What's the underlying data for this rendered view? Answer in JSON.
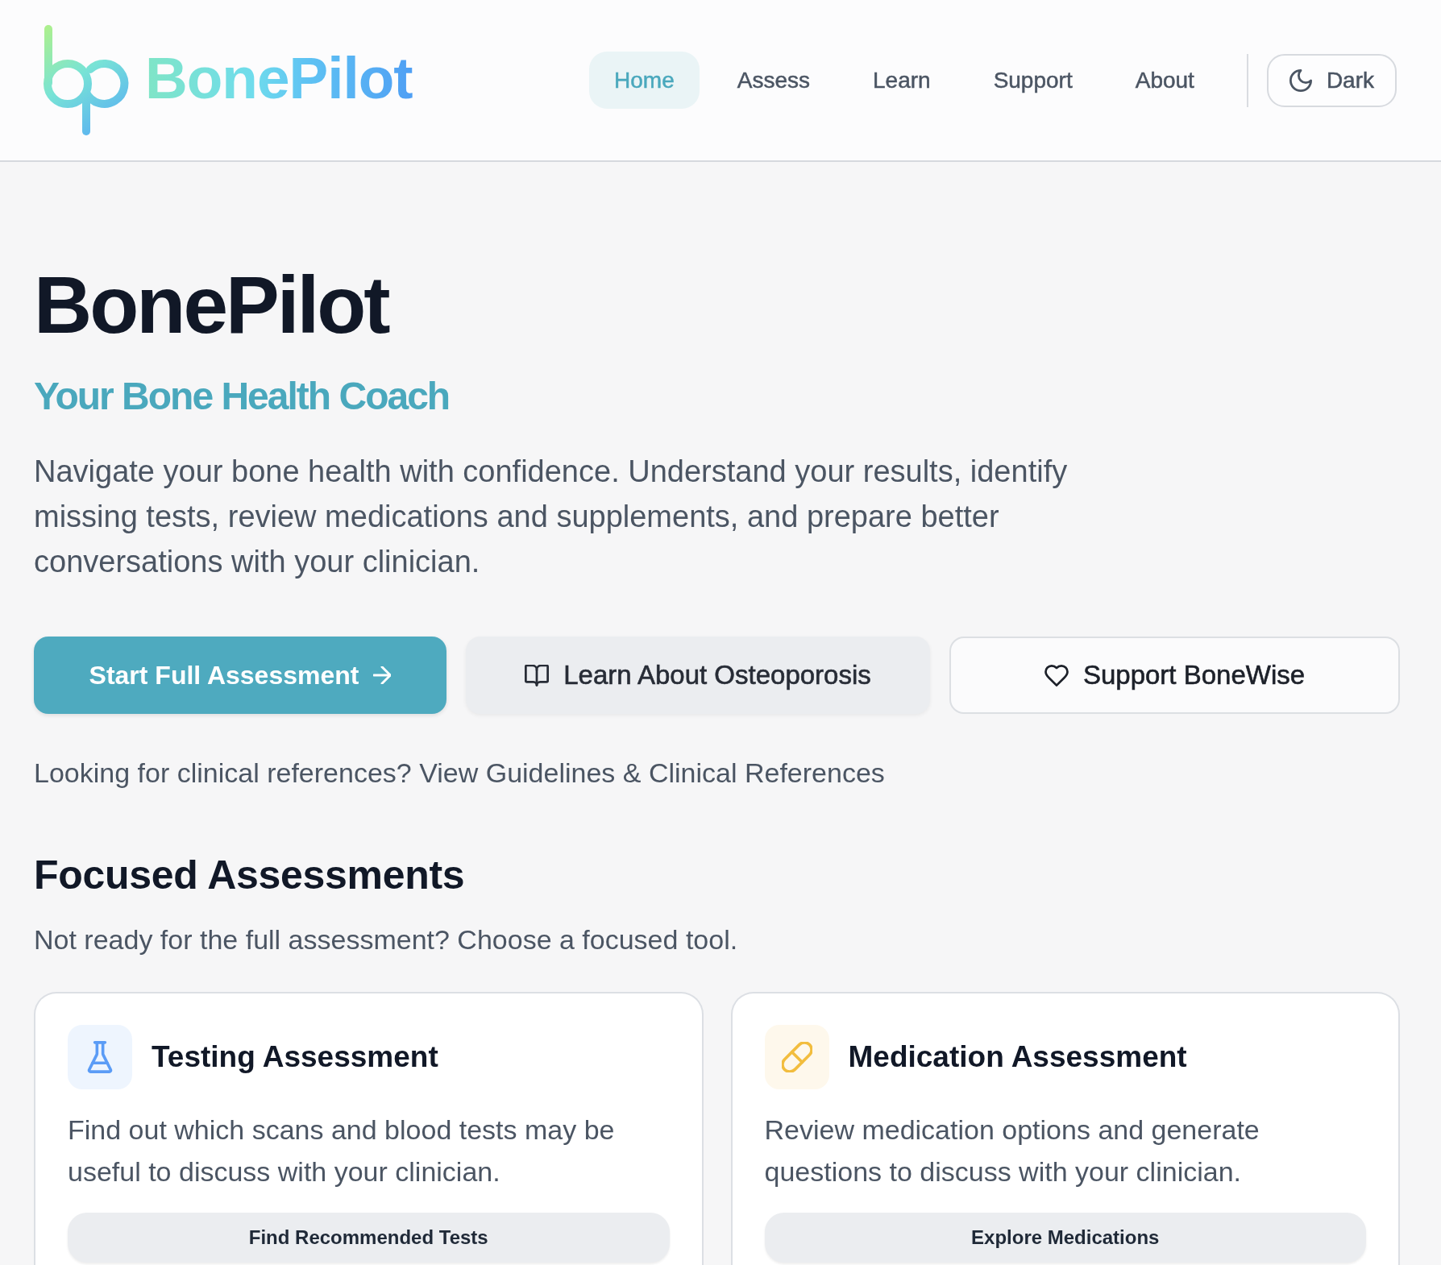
{
  "header": {
    "logo_text": "BonePilot",
    "nav": [
      {
        "label": "Home",
        "selected": true
      },
      {
        "label": "Assess",
        "selected": false
      },
      {
        "label": "Learn",
        "selected": false
      },
      {
        "label": "Support",
        "selected": false
      },
      {
        "label": "About",
        "selected": false
      }
    ],
    "theme_toggle": "Dark"
  },
  "hero": {
    "title": "BonePilot",
    "subtitle": "Your Bone Health Coach",
    "description": "Navigate your bone health with confidence. Understand your results, identify missing tests, review medications and supplements, and prepare better conversations with your clinician.",
    "actions": [
      {
        "label": "Start Full Assessment",
        "kind": "primary"
      },
      {
        "label": "Learn About Osteoporosis",
        "kind": "secondary"
      },
      {
        "label": "Support BoneWise",
        "kind": "outline"
      }
    ],
    "references": {
      "text": "Looking for clinical references?",
      "link": "View Guidelines & Clinical References"
    }
  },
  "focused": {
    "title": "Focused Assessments",
    "subtitle": "Not ready for the full assessment? Choose a focused tool.",
    "cards": [
      {
        "kind": "testing",
        "title": "Testing Assessment",
        "description": "Find out which scans and blood tests may be useful to discuss with your clinician.",
        "button": "Find Recommended Tests"
      },
      {
        "kind": "medication",
        "title": "Medication Assessment",
        "description": "Review medication options and generate questions to discuss with your clinician.",
        "button": "Explore Medications"
      }
    ]
  }
}
